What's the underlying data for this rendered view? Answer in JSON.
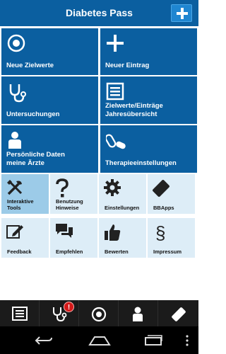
{
  "header": {
    "title": "Diabetes Pass"
  },
  "tiles": {
    "neue_zielwerte": "Neue Zielwerte",
    "neuer_eintrag": "Neuer Eintrag",
    "untersuchungen": "Untersuchungen",
    "zielwerte_line1": "Zielwerte/Einträge",
    "zielwerte_line2": "Jahresübersicht",
    "persoenliche_line1": "Persönliche Daten",
    "persoenliche_line2": "meine Ärzte",
    "therapie": "Therapieeinstellungen"
  },
  "small_tiles": {
    "interaktive_line1": "Interaktive",
    "interaktive_line2": "Tools",
    "benutzung_line1": "Benutzung",
    "benutzung_line2": "Hinweise",
    "einstellungen": "Einstellungen",
    "bbapps": "BBApps",
    "feedback": "Feedback",
    "empfehlen": "Empfehlen",
    "bewerten": "Bewerten",
    "impressum": "Impressum"
  },
  "tabbar": {
    "badge_count": "!"
  },
  "colors": {
    "primary": "#0b5fa0",
    "light_tile": "#ddedf7",
    "active_tile": "#9ccbe8",
    "badge": "#d31919"
  }
}
